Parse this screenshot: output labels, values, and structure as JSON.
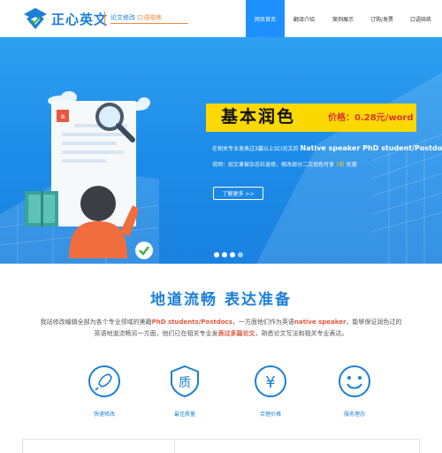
{
  "header": {
    "brand": "正心英文",
    "tagline": {
      "part1": "论文修改",
      "part2": "口语陪练"
    },
    "nav": [
      "网页首页",
      "翻译介绍",
      "案例展示",
      "订购/发票",
      "口语陪练"
    ]
  },
  "banner": {
    "title": "基本润色",
    "price": "价格：0.28元/word",
    "desc1_pre": "在相关专业发表过3篇以上SCI论文的",
    "desc1_highlight": "Native speaker PhD student/Postdocs",
    "desc2_pre": "说明：如文章被杂志社返修，修改部分二次润色可享",
    "desc2_pct": "7折",
    "desc2_post": "优惠",
    "more": "了解更多 >>",
    "slides": 4,
    "active_slide": 1
  },
  "section": {
    "title": "地道流畅  表达准备",
    "p1_a": "我站修改编辑全部为各个专业领域的美籍",
    "p1_b": "PhD students/Postdocs",
    "p1_c": "，一方面他们作为英语",
    "p1_d": "native speaker",
    "p1_e": "，能够保证润色过的",
    "p2_a": "英语地道流畅另一方面，他们已在相关专业发",
    "p2_b": "表过多篇论文",
    "p2_c": "，熟悉论文写法和相关专业表达。",
    "features": [
      {
        "label": "快速修改",
        "icon": "rocket-icon"
      },
      {
        "label": "最佳质量",
        "icon": "quality-badge-icon"
      },
      {
        "label": "合理价格",
        "icon": "yen-icon"
      },
      {
        "label": "服务理念",
        "icon": "smile-icon"
      }
    ]
  },
  "colors": {
    "primary": "#1e90ff",
    "accent": "#f08a3c",
    "highlight": "#fbd900"
  }
}
